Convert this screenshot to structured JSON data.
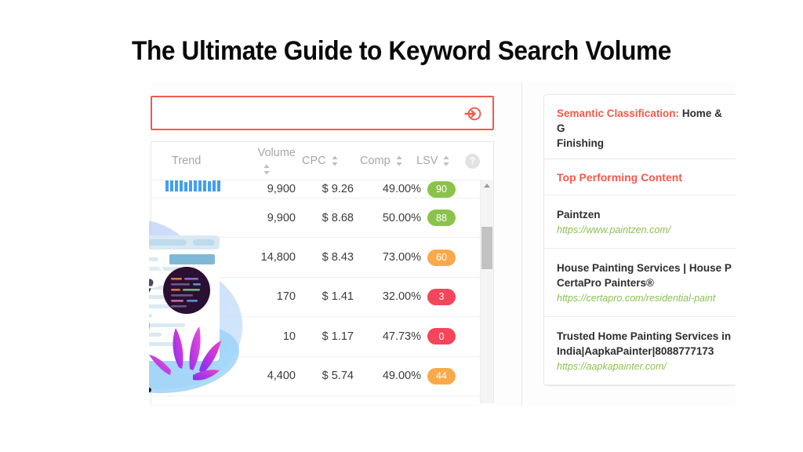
{
  "title": "The Ultimate Guide to Keyword Search Volume",
  "colors": {
    "accent_red": "#f4594a",
    "badge_green": "#8bc34a",
    "badge_orange": "#f9a94a",
    "badge_red": "#f4455a",
    "spark_blue": "#3fa0f5",
    "url_green": "#8cc152"
  },
  "search": {
    "value": "",
    "placeholder": "",
    "go_icon": "arrow-enter-circle-icon"
  },
  "table": {
    "columns": [
      {
        "key": "trend",
        "label": "Trend",
        "sortable": false
      },
      {
        "key": "volume",
        "label": "Volume",
        "sortable": true
      },
      {
        "key": "cpc",
        "label": "CPC",
        "sortable": true
      },
      {
        "key": "comp",
        "label": "Comp",
        "sortable": true
      },
      {
        "key": "lsv",
        "label": "LSV",
        "sortable": true
      }
    ],
    "help_icon_label": "?",
    "rows": [
      {
        "trend": [
          16,
          22,
          14,
          20,
          12,
          24,
          18,
          15,
          21,
          13,
          19,
          23
        ],
        "volume": "9,900",
        "cpc": "$ 9.26",
        "comp": "49.00%",
        "lsv": "90",
        "lsv_color": "#8bc34a",
        "clipped_top": true
      },
      {
        "trend": [],
        "volume": "9,900",
        "cpc": "$ 8.68",
        "comp": "50.00%",
        "lsv": "88",
        "lsv_color": "#8bc34a",
        "clipped_top": false
      },
      {
        "trend": [],
        "volume": "14,800",
        "cpc": "$ 8.43",
        "comp": "73.00%",
        "lsv": "60",
        "lsv_color": "#f9a94a",
        "clipped_top": false
      },
      {
        "trend": [],
        "volume": "170",
        "cpc": "$ 1.41",
        "comp": "32.00%",
        "lsv": "3",
        "lsv_color": "#f4455a",
        "clipped_top": false
      },
      {
        "trend": [],
        "volume": "10",
        "cpc": "$ 1.17",
        "comp": "47.73%",
        "lsv": "0",
        "lsv_color": "#f4455a",
        "clipped_top": false
      },
      {
        "trend": [],
        "volume": "4,400",
        "cpc": "$ 5.74",
        "comp": "49.00%",
        "lsv": "44",
        "lsv_color": "#f9a94a",
        "clipped_top": false
      }
    ]
  },
  "right_panel": {
    "semantic": {
      "label": "Semantic Classification:",
      "value": " Home & G",
      "line2": "Finishing"
    },
    "top_content": {
      "heading": "Top Performing Content",
      "items": [
        {
          "title": "Paintzen",
          "title_line2": "",
          "url": "https://www.paintzen.com/"
        },
        {
          "title": "House Painting Services | House P",
          "title_line2": "CertaPro Painters®",
          "url": "https://certapro.com/residential-paint"
        },
        {
          "title": "Trusted Home Painting Services in",
          "title_line2": "India|AapkaPainter|8088777173",
          "url": "https://aapkapainter.com/"
        }
      ]
    }
  }
}
